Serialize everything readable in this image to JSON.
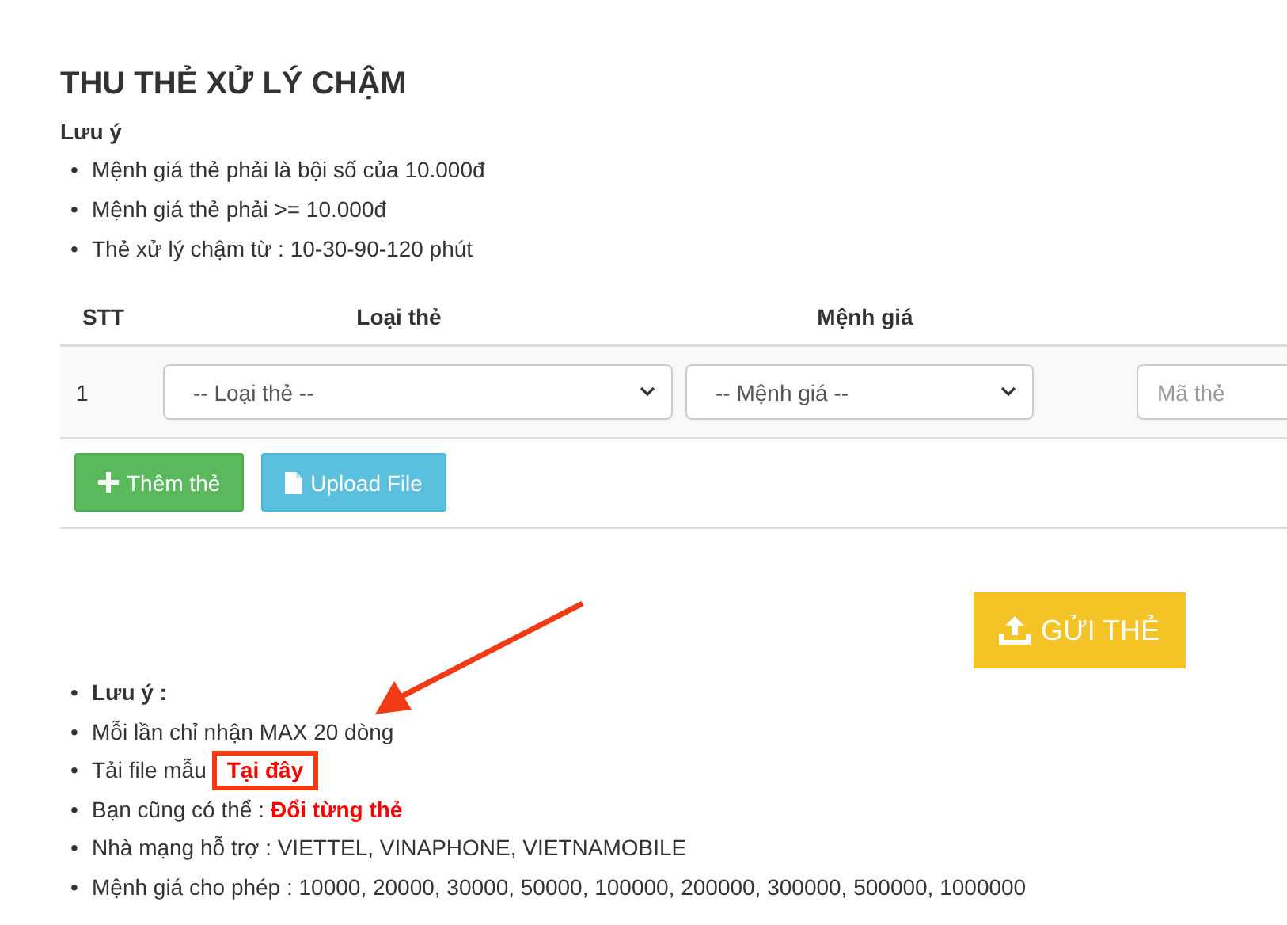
{
  "title": "THU THẺ XỬ LÝ CHẬM",
  "note_heading": "Lưu ý",
  "notes": [
    {
      "bullet": "•",
      "text": "Mệnh giá thẻ phải là bội số của 10.000đ"
    },
    {
      "bullet": "•",
      "text": "Mệnh giá thẻ phải >= 10.000đ"
    },
    {
      "bullet": "•",
      "text": "Thẻ xử lý chậm từ : 10-30-90-120 phút"
    }
  ],
  "table": {
    "columns": [
      "STT",
      "Loại thẻ",
      "Mệnh giá"
    ],
    "rows": [
      {
        "stt": "1",
        "card_type": "-- Loại thẻ --",
        "value": "-- Mệnh giá --",
        "code_placeholder": "Mã thẻ"
      }
    ]
  },
  "buttons": [
    {
      "kind": "add",
      "label": "Thêm thẻ"
    },
    {
      "kind": "upload",
      "label": "Upload File"
    }
  ],
  "submit": "GỬI THẺ",
  "info": [
    {
      "kind": "heading",
      "bullet": "•",
      "text": "Lưu ý :"
    },
    {
      "kind": "text",
      "bullet": "•",
      "text": "Mỗi lần chỉ nhận MAX 20 dòng"
    },
    {
      "kind": "link",
      "bullet": "•",
      "text": "Tải file mẫu",
      "link": "Tại đây",
      "highlighted": true
    },
    {
      "kind": "link",
      "bullet": "•",
      "text": "Bạn cũng có thể :",
      "link": "Đổi từng thẻ",
      "highlighted": false
    },
    {
      "kind": "text",
      "bullet": "•",
      "text": "Nhà mạng hỗ trợ : VIETTEL, VINAPHONE, VIETNAMOBILE"
    },
    {
      "kind": "text",
      "bullet": "•",
      "text": "Mệnh giá cho phép : 10000, 20000, 30000, 50000, 100000, 200000, 300000, 500000, 1000000"
    }
  ]
}
